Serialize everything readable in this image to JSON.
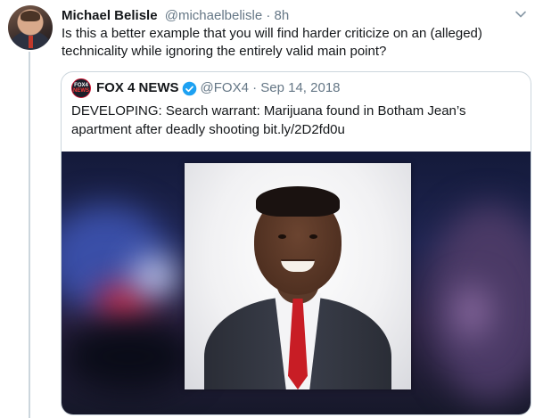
{
  "tweet": {
    "author_name": "Michael Belisle",
    "author_handle": "@michaelbelisle",
    "separator": "·",
    "time": "8h",
    "text": "Is this a better example that you will find harder criticize on an (alleged) technicality while ignoring the entirely valid main point?"
  },
  "quote": {
    "logo_top": "FOX4",
    "logo_bottom": "NEWS",
    "name": "FOX 4 NEWS",
    "handle": "@FOX4",
    "separator": "·",
    "date": "Sep 14, 2018",
    "text": "DEVELOPING: Search warrant: Marijuana found in Botham Jean’s apartment after deadly shooting bit.ly/2D2fd0u"
  },
  "icons": {
    "more": "chevron-down-icon",
    "verified": "verified-badge-icon"
  },
  "colors": {
    "verified_blue": "#1da1f2",
    "secondary_text": "#657786",
    "border": "#ccd6dd"
  }
}
